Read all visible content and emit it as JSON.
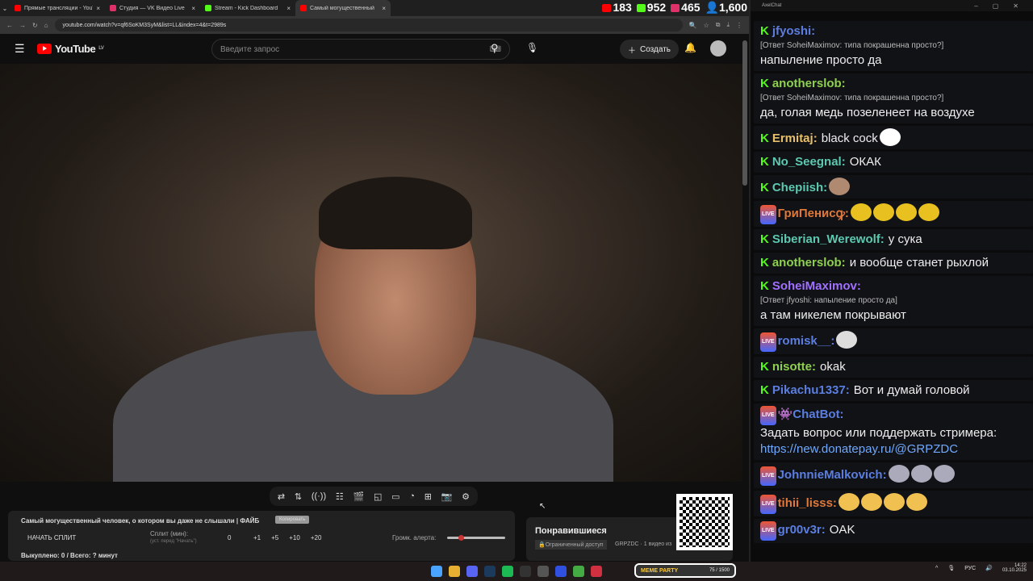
{
  "browser": {
    "tabs": [
      {
        "title": "Прямые трансляции - YouTube",
        "color": "#ff0000"
      },
      {
        "title": "Студия — VK Видео Live",
        "color": "#e0306a"
      },
      {
        "title": "Stream - Kick Dashboard",
        "color": "#53fc18"
      },
      {
        "title": "Самый могущественный",
        "color": "#ff0000"
      }
    ],
    "url": "youtube.com/watch?v=qf6SoKM3SyM&list=LL&index=4&t=2989s"
  },
  "viewers": {
    "youtube": "183",
    "kick": "952",
    "vk": "465",
    "total": "1,600"
  },
  "youtube": {
    "logo": "YouTube",
    "region": "LV",
    "search_placeholder": "Введите запрос",
    "create": "Создать"
  },
  "panel": {
    "title": "Самый могущественный человек, о котором вы даже не слышали | ФАЙБ",
    "copy": "Копировать",
    "start_split": "НАЧАТЬ СПЛИТ",
    "split_label": "Сплит (мин):",
    "split_hint": "(уст. перед \"Начать\")",
    "split_value": "0",
    "steps": [
      "+1",
      "+5",
      "+10",
      "+20"
    ],
    "volume_label": "Громк. алерта:",
    "volume_level": 0.2,
    "bought": "Выкуплено: 0 / Всего: ? минут"
  },
  "liked": {
    "title": "Понравившиеся",
    "access": "Ограниченный доступ",
    "meta": "GRPZDC · 1 видео из"
  },
  "overlay": {
    "meme": "MEME PARTY",
    "progress": "75 / 1500"
  },
  "tray": {
    "lang": "РУС",
    "time": "14:22",
    "date": "03.10.2025"
  },
  "chat": {
    "window_title": "AxelChat",
    "messages": [
      {
        "platform": "kick",
        "nick": "jfyoshi:",
        "color": "#5b7ee0",
        "reply": "[Ответ SoheiMaximov: типа покрашенна просто?]",
        "text": "напыление просто да",
        "block": true
      },
      {
        "platform": "kick",
        "nick": "anotherslob:",
        "color": "#8fd14f",
        "reply": "[Ответ SoheiMaximov: типа покрашенна просто?]",
        "text": "да, голая медь позеленеет на воздухе",
        "block": true
      },
      {
        "platform": "kick",
        "nick": "Ermitaj:",
        "color": "#e8c06a",
        "text": "black cock",
        "emotes": 1,
        "emote_color": "#fff"
      },
      {
        "platform": "kick",
        "nick": "No_Seegnal:",
        "color": "#5cc9b0",
        "text": "ОКАК"
      },
      {
        "platform": "kick",
        "nick": "Chepiish:",
        "color": "#5cc9b0",
        "text": "",
        "emotes": 1,
        "emote_color": "#b08a70"
      },
      {
        "platform": "vk",
        "nick": "ГриПенисꝙ:",
        "color": "#e0783a",
        "text": "",
        "emotes": 4,
        "emote_color": "#e8c020"
      },
      {
        "platform": "kick",
        "nick": "Siberian_Werewolf:",
        "color": "#5cc9b0",
        "text": "у сука"
      },
      {
        "platform": "kick",
        "nick": "anotherslob:",
        "color": "#8fd14f",
        "text": "и вообще станет рыхлой"
      },
      {
        "platform": "kick",
        "nick": "SoheiMaximov:",
        "color": "#a070ff",
        "reply": "[Ответ jfyoshi: напыление просто да]",
        "text": "а там никелем покрывают",
        "block": true
      },
      {
        "platform": "vk",
        "nick": "romisk__:",
        "color": "#5b7ee0",
        "text": "",
        "emotes": 1,
        "emote_color": "#ddd"
      },
      {
        "platform": "kick",
        "nick": "nisotte:",
        "color": "#8fd14f",
        "text": "okak"
      },
      {
        "platform": "kick",
        "nick": "Pikachu1337:",
        "color": "#5b7ee0",
        "text": "Вот и думай головой"
      },
      {
        "platform": "vk",
        "nick": "👾ChatBot:",
        "color": "#5b7ee0",
        "text": "Задать вопрос или поддержать стримера:",
        "link": "https://new.donatepay.ru/@GRPZDC",
        "block": true
      },
      {
        "platform": "vk",
        "nick": "JohnnieMalkovich:",
        "color": "#5b7ee0",
        "text": "",
        "emotes": 3,
        "emote_color": "#aab"
      },
      {
        "platform": "vk",
        "nick": "tihii_lisss:",
        "color": "#e0783a",
        "text": "",
        "emotes": 4,
        "emote_color": "#f0c050"
      },
      {
        "platform": "vk",
        "nick": "gr00v3r:",
        "color": "#5b7ee0",
        "text": "OAK"
      }
    ]
  }
}
